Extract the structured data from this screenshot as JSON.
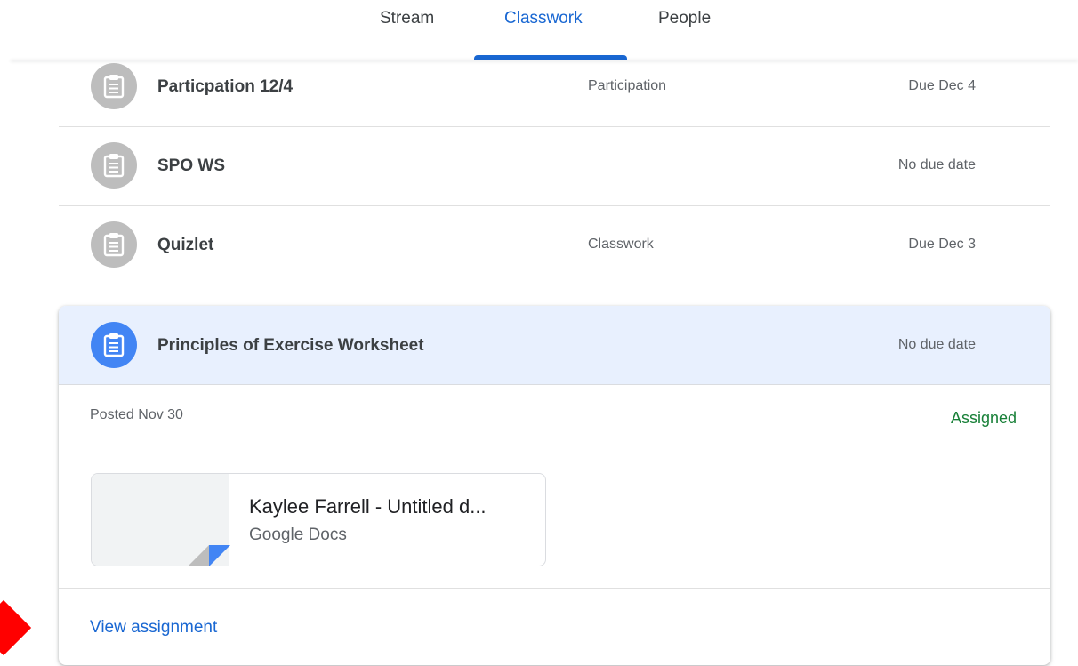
{
  "tabs": [
    {
      "label": "Stream",
      "active": false
    },
    {
      "label": "Classwork",
      "active": true
    },
    {
      "label": "People",
      "active": false
    }
  ],
  "accent_color": "#1967d2",
  "assignments": [
    {
      "title": "Particpation 12/4",
      "topic": "Participation",
      "due": "Due Dec 4",
      "icon": "assignment-icon"
    },
    {
      "title": "SPO WS",
      "topic": "",
      "due": "No due date",
      "icon": "assignment-icon"
    },
    {
      "title": "Quizlet",
      "topic": "Classwork",
      "due": "Due Dec 3",
      "icon": "assignment-icon"
    }
  ],
  "expanded": {
    "title": "Principles of Exercise Worksheet",
    "due": "No due date",
    "posted": "Posted Nov 30",
    "status": "Assigned",
    "status_color": "#188038",
    "attachment": {
      "title": "Kaylee Farrell - Untitled d...",
      "type": "Google Docs"
    },
    "view_link": "View assignment"
  }
}
